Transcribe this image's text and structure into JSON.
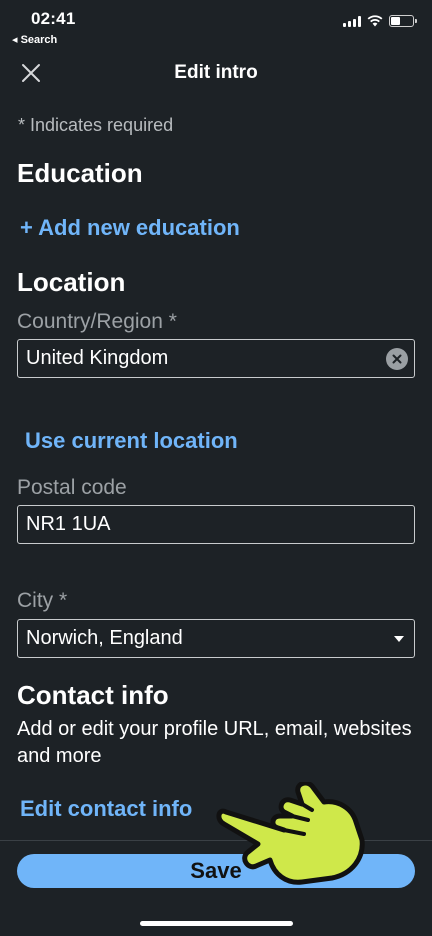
{
  "status_bar": {
    "time": "02:41",
    "back_app": "◂ Search"
  },
  "header": {
    "title": "Edit intro",
    "close_icon": "close-icon"
  },
  "form": {
    "required_note": "* Indicates required",
    "education_heading": "Education",
    "add_education_label": "+ Add new education",
    "location_heading": "Location",
    "country_label": "Country/Region *",
    "country_value": "United Kingdom",
    "use_location_label": "Use current location",
    "postal_label": "Postal code",
    "postal_value": "NR1 1UA",
    "city_label": "City *",
    "city_value": "Norwich, England",
    "contact_heading": "Contact info",
    "contact_desc": "Add or edit your profile URL, email, websites and more",
    "edit_contact_label": "Edit contact info"
  },
  "footer": {
    "save_label": "Save"
  },
  "colors": {
    "background": "#1d2226",
    "accent": "#70b5f9",
    "muted_text": "#9ca1a5",
    "pointer_fill": "#cfe84a"
  }
}
